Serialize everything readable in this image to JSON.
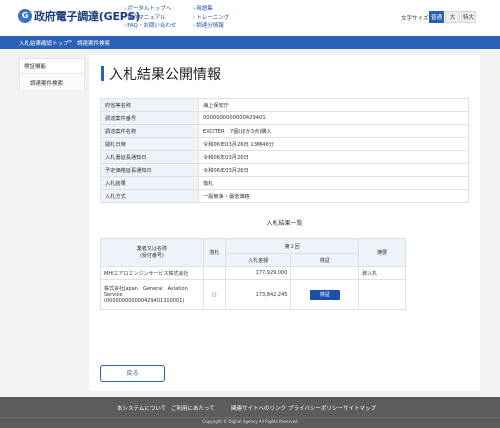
{
  "header": {
    "logo_mark": "G",
    "logo_text": "政府電子調達(GEPS)",
    "links": [
      "ポータルトップへ",
      "操作マニュアル",
      "FAQ・お問い合わせ",
      "用語集",
      "トレーニング",
      "調達分情報"
    ],
    "font_size_label": "文字サイズ",
    "font_sizes": [
      "普通",
      "大",
      "特大"
    ]
  },
  "breadcrumb": [
    "入札結果確認トップ",
    "調達案件検索"
  ],
  "sidebar": {
    "heading": "検証機能",
    "item": "調達案件検索"
  },
  "page": {
    "title": "入札結果公開情報"
  },
  "info_rows": [
    {
      "label": "府省等名称",
      "value": "海上保安庁"
    },
    {
      "label": "調達案件番号",
      "value": "0000000000000429401"
    },
    {
      "label": "調達案件名称",
      "value": "EXCITER　7個(ほか3点)購入"
    },
    {
      "label": "開札日時",
      "value": "令和06年03月26日 13時46分"
    },
    {
      "label": "入札書延長通知日",
      "value": "令和06年03月26日"
    },
    {
      "label": "予定価格延長通知日",
      "value": "令和06年03月26日"
    },
    {
      "label": "入札結果",
      "value": "落札"
    },
    {
      "label": "入札方式",
      "value": "一般競争・最低価格"
    }
  ],
  "results": {
    "heading": "入札結果一覧",
    "col_company": "業者又は名称\n(受付番号)",
    "col_award": "落札",
    "col_round": "第１回",
    "col_amount": "入札金額",
    "col_check": "検証",
    "col_note": "摘要",
    "rows": [
      {
        "company": "MHIエアロエンジンサービス株式会社",
        "award": "",
        "amount": "177,929,000",
        "check": "",
        "note": "辞入札"
      },
      {
        "company": "株式会社Japan　General　Aviation Service\n(000000000000429401310001)",
        "award": "○",
        "amount": "173,842,245",
        "check": "検証",
        "note": ""
      }
    ]
  },
  "back_label": "戻る",
  "footer": {
    "links": [
      "本システムについて",
      "ご利用にあたって",
      "関連サイトへのリンク",
      "プライバシーポリシー",
      "サイトマップ"
    ],
    "copyright": "Copyright © Digital Agency All Rights Reserved"
  }
}
